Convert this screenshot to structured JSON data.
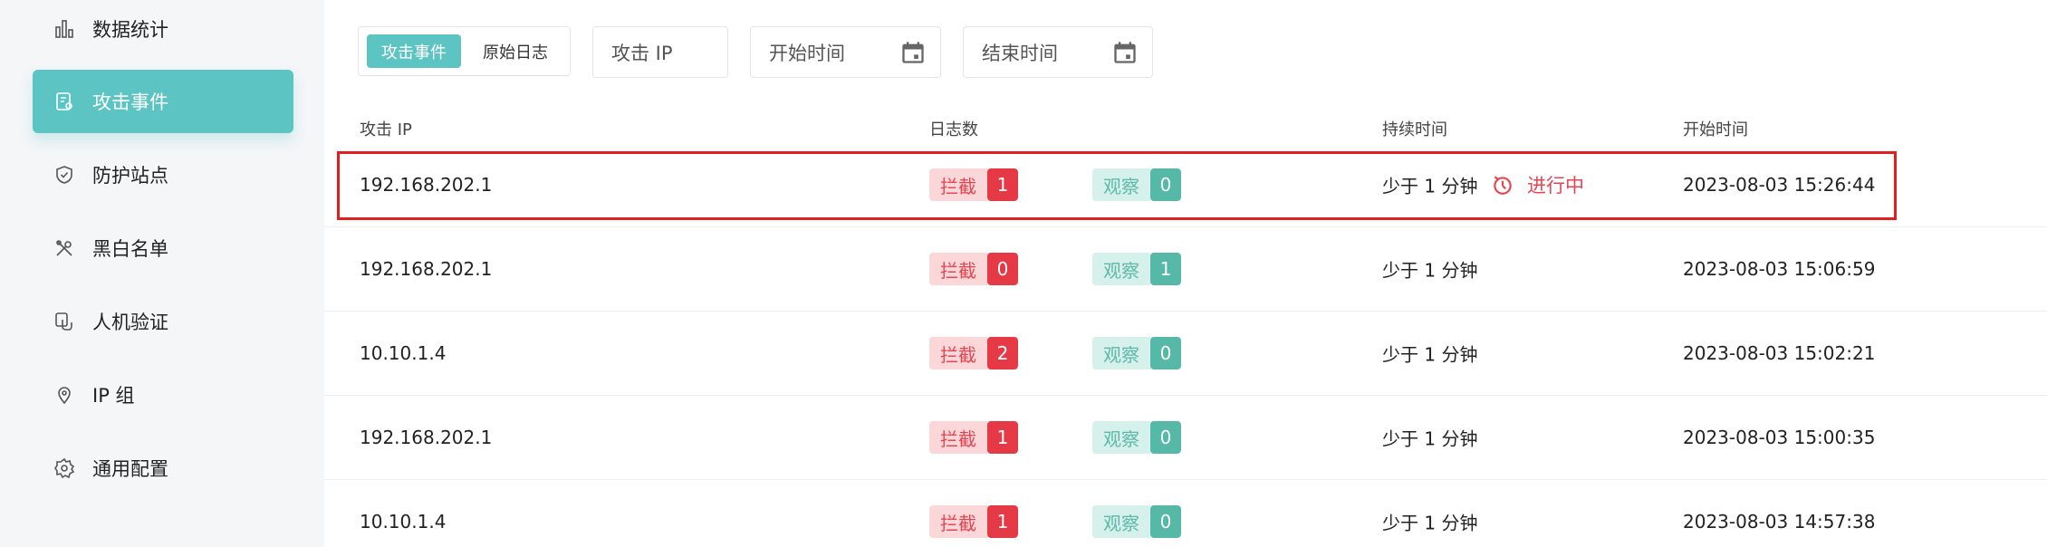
{
  "sidebar": {
    "items": [
      {
        "label": "数据统计",
        "icon": "bar-chart-icon",
        "active": false
      },
      {
        "label": "攻击事件",
        "icon": "event-document-icon",
        "active": true
      },
      {
        "label": "防护站点",
        "icon": "shield-icon",
        "active": false
      },
      {
        "label": "黑白名单",
        "icon": "tools-icon",
        "active": false
      },
      {
        "label": "人机验证",
        "icon": "verify-hand-icon",
        "active": false
      },
      {
        "label": "IP 组",
        "icon": "location-pin-icon",
        "active": false
      },
      {
        "label": "通用配置",
        "icon": "gear-icon",
        "active": false
      }
    ]
  },
  "filters": {
    "tabs": [
      "攻击事件",
      "原始日志"
    ],
    "ip_placeholder": "攻击 IP",
    "start_placeholder": "开始时间",
    "end_placeholder": "结束时间"
  },
  "table": {
    "headers": {
      "ip": "攻击 IP",
      "logs": "日志数",
      "duration": "持续时间",
      "start": "开始时间"
    },
    "block_label": "拦截",
    "observe_label": "观察",
    "rows": [
      {
        "ip": "192.168.202.1",
        "block": "1",
        "observe": "0",
        "duration": "少于 1 分钟",
        "status": "进行中",
        "start": "2023-08-03 15:26:44"
      },
      {
        "ip": "192.168.202.1",
        "block": "0",
        "observe": "1",
        "duration": "少于 1 分钟",
        "status": "",
        "start": "2023-08-03 15:06:59"
      },
      {
        "ip": "10.10.1.4",
        "block": "2",
        "observe": "0",
        "duration": "少于 1 分钟",
        "status": "",
        "start": "2023-08-03 15:02:21"
      },
      {
        "ip": "192.168.202.1",
        "block": "1",
        "observe": "0",
        "duration": "少于 1 分钟",
        "status": "",
        "start": "2023-08-03 15:00:35"
      },
      {
        "ip": "10.10.1.4",
        "block": "1",
        "observe": "0",
        "duration": "少于 1 分钟",
        "status": "",
        "start": "2023-08-03 14:57:38"
      }
    ]
  },
  "colors": {
    "accent": "#5cc4c2",
    "block": "#e63946",
    "observe": "#56b8a6",
    "highlight": "#e02020"
  }
}
